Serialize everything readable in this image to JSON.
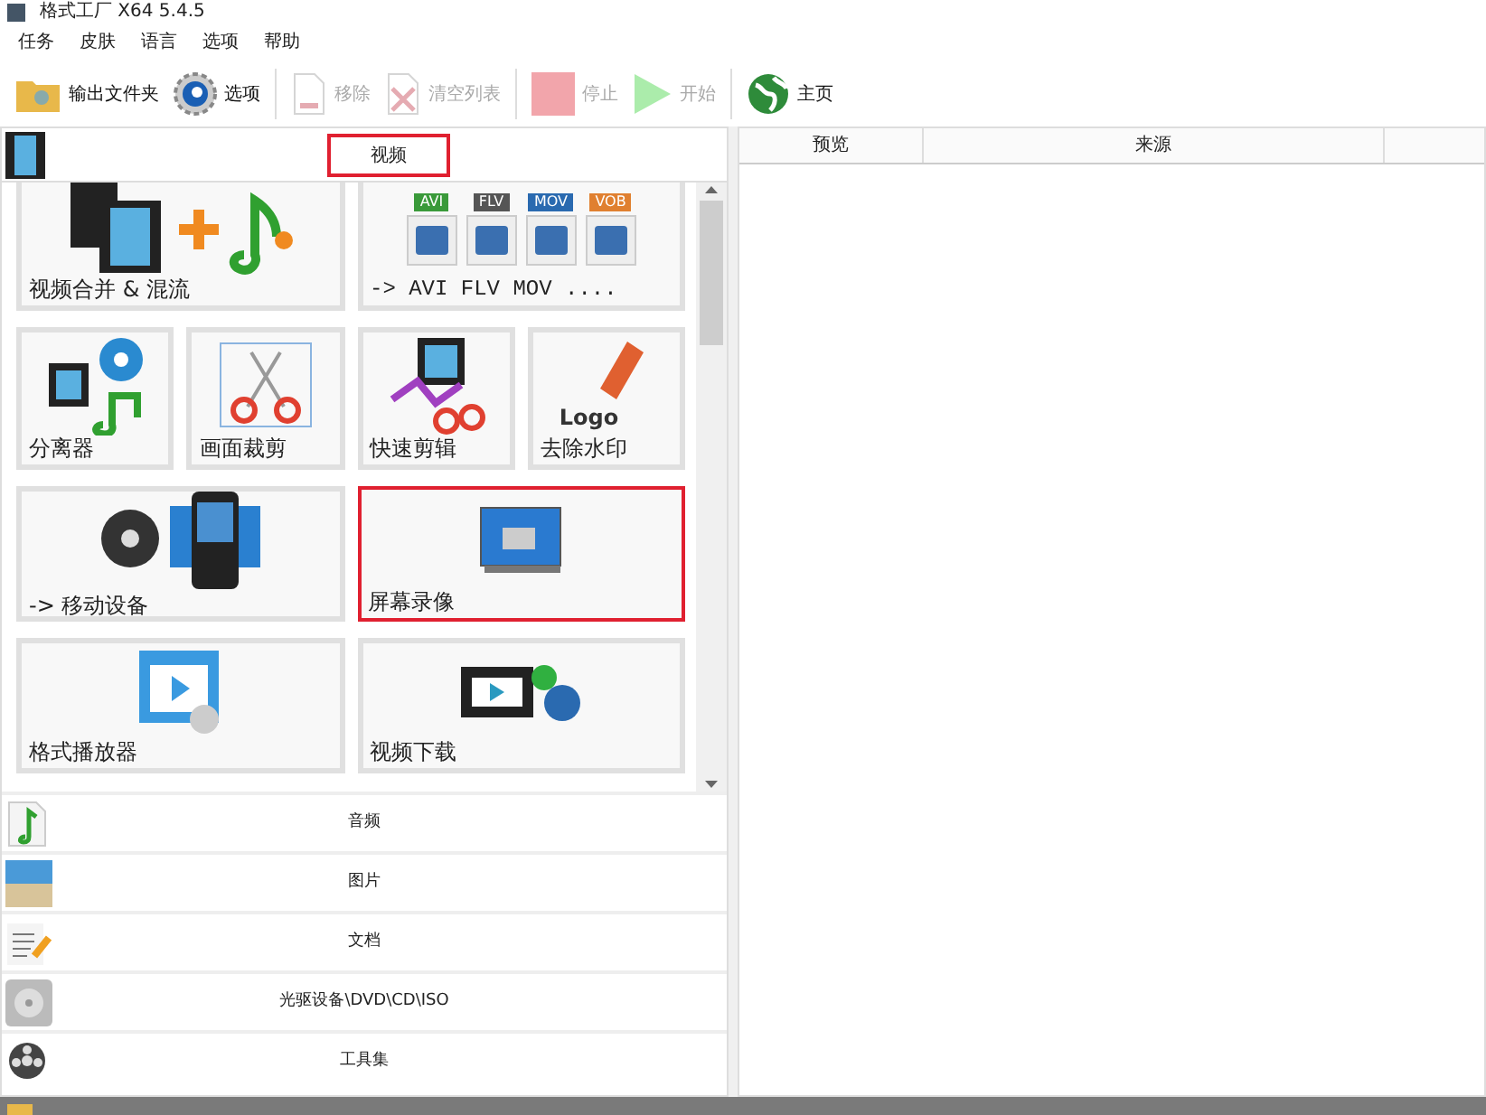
{
  "window": {
    "title": "格式工厂 X64 5.4.5"
  },
  "menu": [
    "任务",
    "皮肤",
    "语言",
    "选项",
    "帮助"
  ],
  "toolbar": [
    {
      "label": "输出文件夹",
      "kind": "folder",
      "disabled": false
    },
    {
      "label": "选项",
      "kind": "gear",
      "disabled": false
    },
    {
      "label": "移除",
      "kind": "remove",
      "disabled": true
    },
    {
      "label": "清空列表",
      "kind": "clear",
      "disabled": true
    },
    {
      "label": "停止",
      "kind": "stop",
      "disabled": true
    },
    {
      "label": "开始",
      "kind": "start",
      "disabled": true
    },
    {
      "label": "主页",
      "kind": "globe",
      "disabled": false
    }
  ],
  "category_header": {
    "label": "视频",
    "highlighted": true
  },
  "tiles": [
    {
      "label": "视频合并 & 混流",
      "kind": "wide",
      "highlighted": false
    },
    {
      "label": "-> AVI FLV MOV ....",
      "kind": "wide",
      "highlighted": false,
      "badges": [
        "AVI",
        "FLV",
        "MOV",
        "VOB"
      ]
    },
    {
      "label": "分离器",
      "kind": "small",
      "highlighted": false
    },
    {
      "label": "画面裁剪",
      "kind": "small",
      "highlighted": false
    },
    {
      "label": "快速剪辑",
      "kind": "small",
      "highlighted": false
    },
    {
      "label": "去除水印",
      "kind": "small",
      "highlighted": false,
      "icon_text": "Logo"
    },
    {
      "label": "-> 移动设备",
      "kind": "wide",
      "highlighted": false
    },
    {
      "label": "屏幕录像",
      "kind": "wide",
      "highlighted": true
    },
    {
      "label": "格式播放器",
      "kind": "wide",
      "highlighted": false
    },
    {
      "label": "视频下载",
      "kind": "wide",
      "highlighted": false
    }
  ],
  "categories": [
    {
      "label": "音频"
    },
    {
      "label": "图片"
    },
    {
      "label": "文档"
    },
    {
      "label": "光驱设备\\DVD\\CD\\ISO"
    },
    {
      "label": "工具集"
    }
  ],
  "table": {
    "columns": [
      "预览",
      "来源"
    ]
  }
}
